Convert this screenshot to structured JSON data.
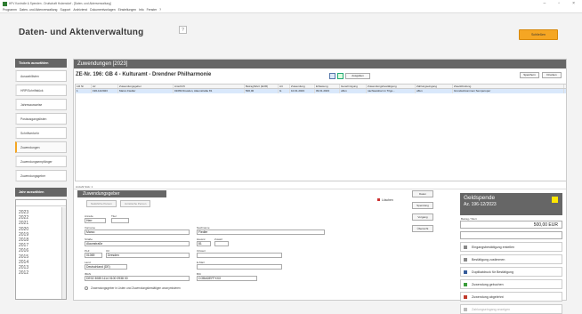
{
  "titlebar": {
    "title": "HFV Kontrolle & Spenden - Drufschaft Holzendorf - [Daten- und Aktenverwaltung]"
  },
  "menubar": {
    "items": [
      "Programm",
      "Daten- und Aktenverwaltung",
      "Support",
      "Archivierst",
      "Dokumentvorlagen",
      "Einstellungen",
      "Info",
      "Fenster",
      "?"
    ]
  },
  "header": {
    "title": "Daten- und Aktenverwaltung",
    "orange_label": "Schließen"
  },
  "sidebar": {
    "head1": "Tickets auswählen",
    "items": [
      "Auswahllisten",
      "HRP/Schriftstück",
      "Jahresausweise",
      "Postausgangslisten",
      "Schriftverkehr",
      "Zuwendungen",
      "Zuwendungsempfänger",
      "Zuwendungsgeber"
    ],
    "head2": "Jahr auswählen",
    "years": [
      "2023",
      "2022",
      "2021",
      "2020",
      "2019",
      "2018",
      "2017",
      "2016",
      "2015",
      "2014",
      "2013",
      "2012"
    ]
  },
  "main": {
    "head": "Zuwendungen [2023]",
    "record_title": "ZE-Nr. 196: GB 4 - Kulturamt - Drendner Philharmonie",
    "tb_label": "Ausgaben",
    "right_btn1": "Speichern",
    "right_btn2": "Drucken",
    "columns": [
      "Lfd Nr",
      "Az",
      "Zuwendungsgeber",
      "Anschrift",
      "Betrag/Wert (EUR)",
      "Art",
      "Zuwendung",
      "Erfassung",
      "Genehmigung",
      "Zuwendungsbestätigung",
      "Zahlungseingang",
      "Zweckbindung"
    ],
    "rows": [
      [
        "1",
        "196-12/2023",
        "Marco Fiedler",
        "01069 Dresden, Alaunstraße 81",
        "500,00",
        "G",
        "10.01.2023",
        "09.01.2023",
        "offen",
        "nachweisbar im Trigo...",
        "offen",
        "Grundeinkommen Semperoper"
      ]
    ],
    "count": "Anzahl Stck: 1"
  },
  "form": {
    "head": "Zuwendungsgeber",
    "radio1": "Natürliche Person",
    "radio2": "Juristische Person",
    "anrede_lbl": "Anrede",
    "anrede": "Herr",
    "titel_lbl": "Titel",
    "titel": "",
    "vorname_lbl": "Vorname",
    "vorname": "Marco",
    "nachname_lbl": "Nachname",
    "nachname": "Fiedler",
    "strasse_lbl": "Straße",
    "strasse": "Alaunstraße",
    "hausnr_lbl": "Hausnr.",
    "hausnr": "81",
    "zusatz_lbl": "Zusatz",
    "zusatz": "",
    "plz_lbl": "PLZ",
    "plz": "01069",
    "ort_lbl": "Ort",
    "ort": "Dresden",
    "ortsteil_lbl": "Ortsteil",
    "ortsteil": "",
    "land_lbl": "Land",
    "land": "Deutschland (DE)",
    "email_lbl": "E-Mail",
    "email": "",
    "iban_lbl": "IBAN",
    "iban": "DE02 3085 1114 0100 0938 00",
    "bic_lbl": "BIC",
    "bic": "COBADEFFXXX",
    "checkbox_lbl": "Zuwendungsgeber in Listen und Zuwendungsbestätigen anonymisieren",
    "delete_lbl": "Löschen"
  },
  "mid_buttons": [
    "Daten",
    "Spendung",
    "Vorgang",
    "Übersicht"
  ],
  "panel": {
    "title": "Geldspende",
    "az": "Az. 196-12/2023",
    "amount_lbl": "Betrag / Wert",
    "amount": "500,00 EUR",
    "actions": [
      {
        "label": "Eingangsbestätigung erstellen",
        "icon": "document-icon",
        "color": "#888",
        "disabled": false
      },
      {
        "label": "Bestätigung zustimmen",
        "icon": "document-icon",
        "color": "#888",
        "disabled": false
      },
      {
        "label": "Duplikatdruck für Bestätigung",
        "icon": "print-icon",
        "color": "#355b9a",
        "disabled": false
      },
      {
        "label": "Zuwendung gebuchen",
        "icon": "check-icon",
        "color": "#3a9c3a",
        "disabled": false
      },
      {
        "label": "Zuwendung abgelehnt",
        "icon": "reject-icon",
        "color": "#c0392b",
        "disabled": false
      },
      {
        "label": "Zahlungseingang anzeigen",
        "icon": "document-icon",
        "color": "#bbb",
        "disabled": true
      }
    ]
  }
}
